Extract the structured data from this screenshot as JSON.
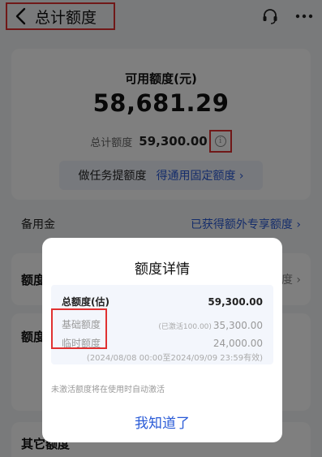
{
  "header": {
    "title": "总计额度",
    "icons": [
      "back-arrow-icon",
      "headset-icon",
      "more-icon"
    ]
  },
  "summary": {
    "available_label": "可用额度(元)",
    "available_amount": "58,681.29",
    "total_label": "总计额度",
    "total_amount": "59,300.00",
    "info_icon_char": "i",
    "task_text": "做任务提额度",
    "task_link": "得通用固定额度 ›"
  },
  "reserve": {
    "label": "备用金",
    "link": "已获得额外专享额度 ›"
  },
  "background_sections": {
    "section1_title": "额度",
    "section1_right": "度 ›",
    "section2_title": "额度",
    "section3_title": "其它额度"
  },
  "modal": {
    "title": "额度详情",
    "rows": {
      "total_label": "总额度(估)",
      "total_value": "59,300.00",
      "base_label": "基础额度",
      "base_note": "(已激活100.00)",
      "base_value": "35,300.00",
      "temp_label": "临时额度",
      "temp_value": "24,000.00",
      "temp_period": "(2024/08/08 00:00至2024/09/09 23:59有效)"
    },
    "tip": "未激活额度将在使用时自动激活",
    "confirm": "我知道了"
  },
  "colors": {
    "accent_blue": "#2a5bd7",
    "highlight_red": "#e03131",
    "page_bg": "#f3f4f6"
  }
}
